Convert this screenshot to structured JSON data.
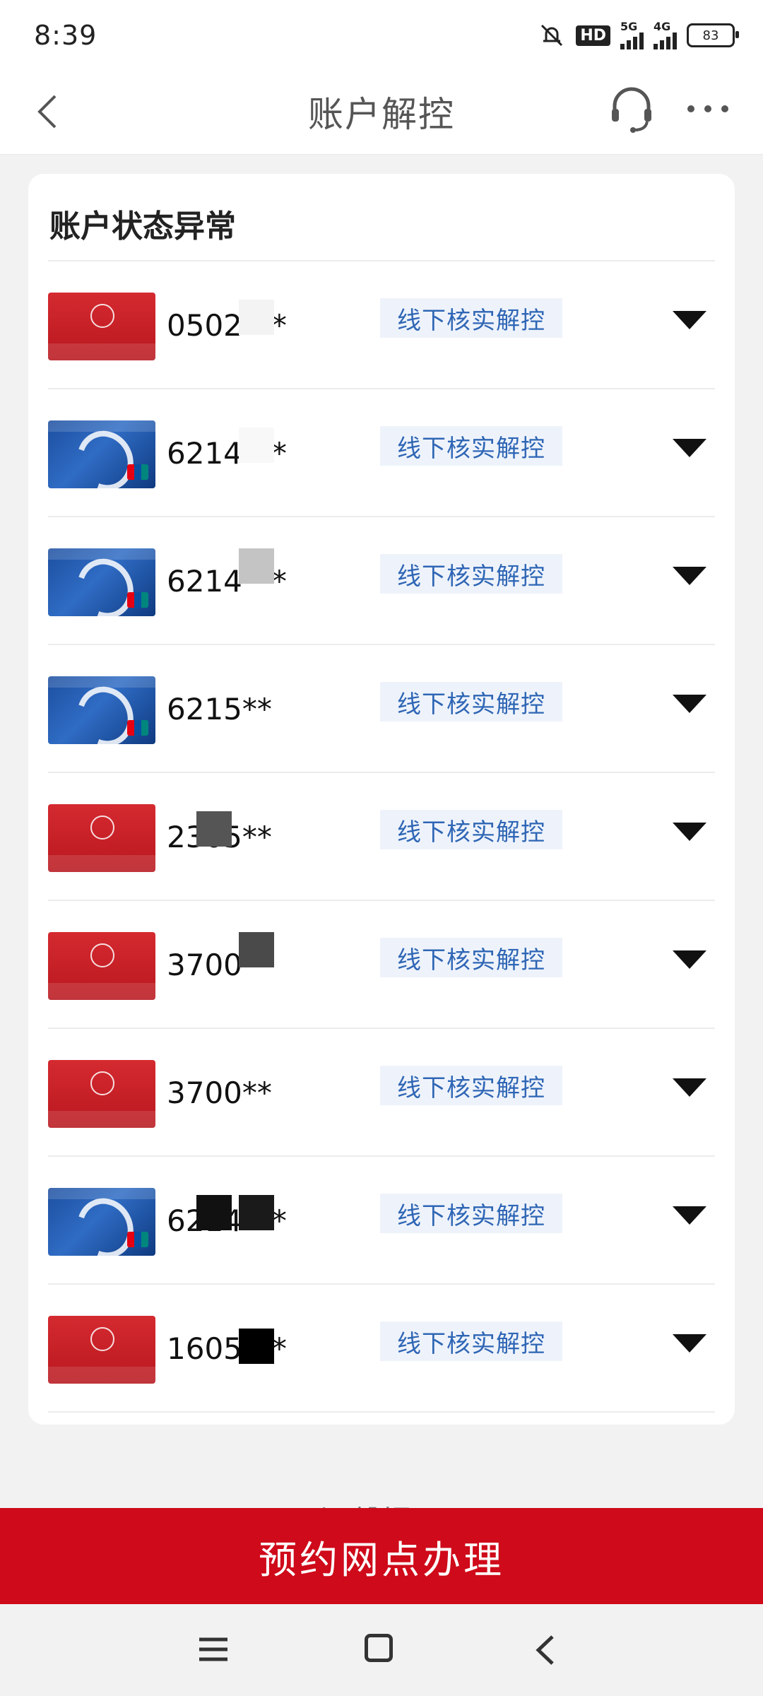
{
  "status_bar": {
    "time": "8:39",
    "hd_label": "HD",
    "network1": "5G",
    "network2": "4G",
    "battery": "83"
  },
  "header": {
    "title": "账户解控",
    "icons": [
      "back-icon",
      "customer-service-icon",
      "more-icon"
    ]
  },
  "panel": {
    "title": "账户状态异常"
  },
  "accounts": [
    {
      "number": "0502***",
      "card": "red",
      "status": "线下核实解控"
    },
    {
      "number": "6214***",
      "card": "blue",
      "status": "线下核实解控"
    },
    {
      "number": "6214***",
      "card": "blue",
      "status": "线下核实解控"
    },
    {
      "number": "6215**",
      "card": "blue",
      "status": "线下核实解控"
    },
    {
      "number": "2305**",
      "card": "red",
      "status": "线下核实解控"
    },
    {
      "number": "3700**",
      "card": "red",
      "status": "线下核实解控"
    },
    {
      "number": "3700**",
      "card": "red",
      "status": "线下核实解控"
    },
    {
      "number": "6214***",
      "card": "blue",
      "status": "线下核实解控"
    },
    {
      "number": "1605***",
      "card": "red",
      "status": "线下核实解控"
    }
  ],
  "hint_text": "温馨提示",
  "action_button": "预约网点办理",
  "colors": {
    "accent": "#cf0a1a",
    "tag_text": "#2f66b5",
    "tag_bg": "#eef3fb"
  }
}
